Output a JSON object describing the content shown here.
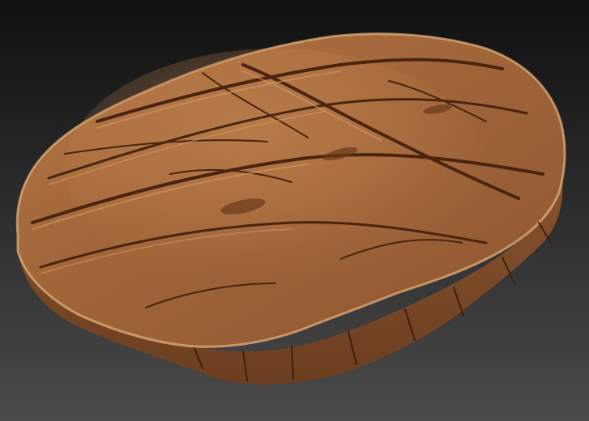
{
  "scene": {
    "subject": "stylized-wooden-disc",
    "colors": {
      "background_top": "#101010",
      "background_bottom": "#4a4a4a",
      "wood_base": "#9a6238",
      "wood_light": "#b97d4c",
      "wood_dark": "#6a3a1c",
      "edge_highlight": "#e0ad78",
      "crack_dark": "#4a240f",
      "side_face": "#7b4a28"
    }
  }
}
